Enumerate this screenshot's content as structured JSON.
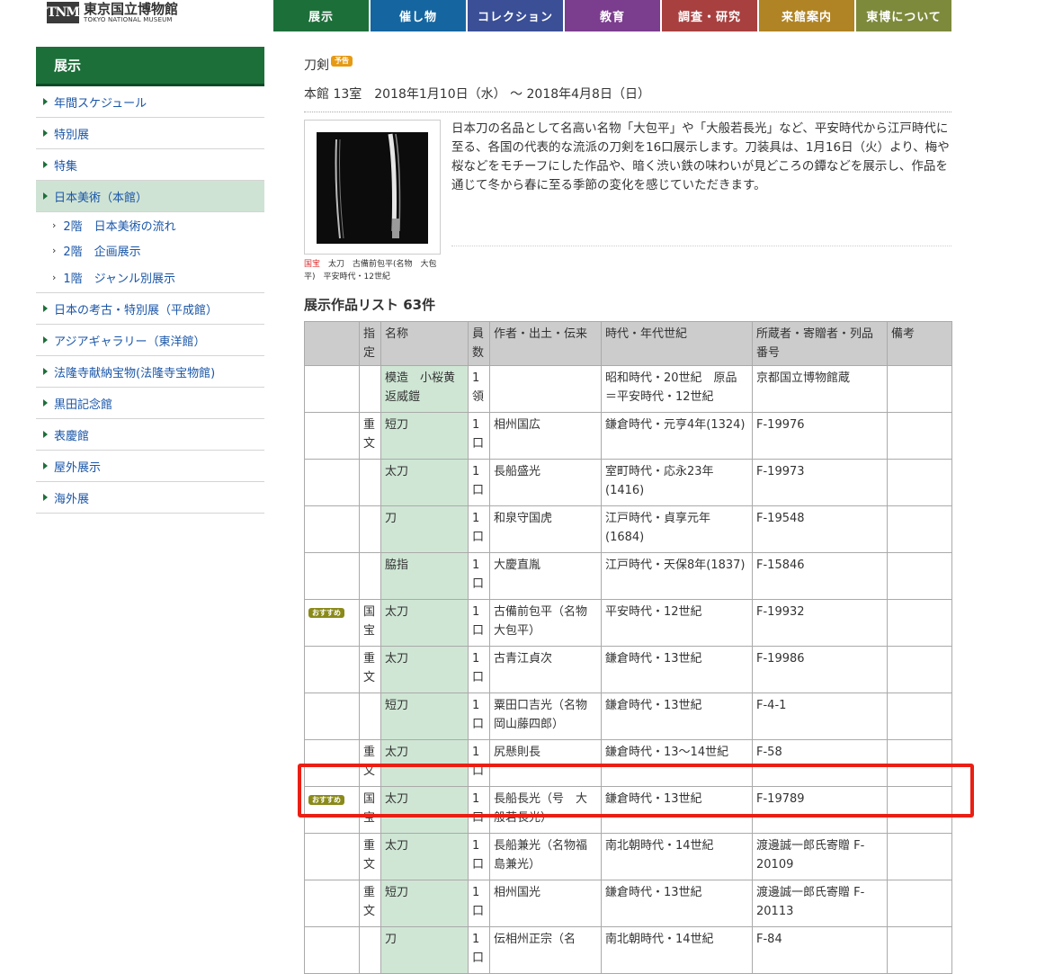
{
  "logo": {
    "mark": "TNM",
    "jp": "東京国立博物館",
    "en": "TOKYO NATIONAL MUSEUM"
  },
  "nav": [
    {
      "label": "展示",
      "color": "#1d6f3a"
    },
    {
      "label": "催し物",
      "color": "#1566a0"
    },
    {
      "label": "コレクション",
      "color": "#3a4f96"
    },
    {
      "label": "教育",
      "color": "#7b3d8e"
    },
    {
      "label": "調査・研究",
      "color": "#a84040"
    },
    {
      "label": "来館案内",
      "color": "#b08424"
    },
    {
      "label": "東博について",
      "color": "#7d8a3c"
    }
  ],
  "sidebar": {
    "heading": "展示",
    "items": [
      {
        "label": "年間スケジュール"
      },
      {
        "label": "特別展"
      },
      {
        "label": "特集"
      },
      {
        "label": "日本美術（本館）"
      },
      {
        "label": "2階　日本美術の流れ"
      },
      {
        "label": "2階　企画展示"
      },
      {
        "label": "1階　ジャンル別展示"
      },
      {
        "label": "日本の考古・特別展（平成館）"
      },
      {
        "label": "アジアギャラリー（東洋館）"
      },
      {
        "label": "法隆寺献納宝物(法隆寺宝物館)"
      },
      {
        "label": "黒田記念館"
      },
      {
        "label": "表慶館"
      },
      {
        "label": "屋外展示"
      },
      {
        "label": "海外展"
      }
    ]
  },
  "exhibit": {
    "title": "刀剣",
    "badge": "予告",
    "meta": "本館 13室　2018年1月10日（水） 〜 2018年4月8日（日）",
    "description": "日本刀の名品として名高い名物「大包平」や「大般若長光」など、平安時代から江戸時代に至る、各国の代表的な流派の刀剣を16口展示します。刀装具は、1月16日（火）より、梅や桜などをモチーフにした作品や、暗く渋い鉄の味わいが見どころの鐔などを展示し、作品を通じて冬から春に至る季節の変化を感じていただきます。",
    "caption_red": "国宝",
    "caption": "　太刀　古備前包平(名物　大包平)　平安時代・12世紀"
  },
  "list": {
    "title": "展示作品リスト 63件",
    "headers": [
      "",
      "指定",
      "名称",
      "員数",
      "作者・出土・伝来",
      "時代・年代世紀",
      "所蔵者・寄贈者・列品番号",
      "備考"
    ],
    "rows": [
      {
        "badge": "",
        "designation": "",
        "name": "模造　小桜黄返威鎧",
        "count": "1領",
        "author": "",
        "period": "昭和時代・20世紀　原品＝平安時代・12世紀",
        "owner": "京都国立博物館蔵",
        "note": ""
      },
      {
        "badge": "",
        "designation": "重文",
        "name": "短刀",
        "count": "1口",
        "author": "相州国広",
        "period": "鎌倉時代・元亨4年(1324)",
        "owner": "F-19976",
        "note": ""
      },
      {
        "badge": "",
        "designation": "",
        "name": "太刀",
        "count": "1口",
        "author": "長船盛光",
        "period": "室町時代・応永23年(1416)",
        "owner": "F-19973",
        "note": ""
      },
      {
        "badge": "",
        "designation": "",
        "name": "刀",
        "count": "1口",
        "author": "和泉守国虎",
        "period": "江戸時代・貞享元年(1684)",
        "owner": "F-19548",
        "note": ""
      },
      {
        "badge": "",
        "designation": "",
        "name": "脇指",
        "count": "1口",
        "author": "大慶直胤",
        "period": "江戸時代・天保8年(1837)",
        "owner": "F-15846",
        "note": ""
      },
      {
        "badge": "おすすめ",
        "designation": "国宝",
        "name": "太刀",
        "count": "1口",
        "author": "古備前包平（名物　大包平）",
        "period": "平安時代・12世紀",
        "owner": "F-19932",
        "note": ""
      },
      {
        "badge": "",
        "designation": "重文",
        "name": "太刀",
        "count": "1口",
        "author": "古青江貞次",
        "period": "鎌倉時代・13世紀",
        "owner": "F-19986",
        "note": ""
      },
      {
        "badge": "",
        "designation": "",
        "name": "短刀",
        "count": "1口",
        "author": "粟田口吉光（名物　岡山藤四郎）",
        "period": "鎌倉時代・13世紀",
        "owner": "F-4-1",
        "note": ""
      },
      {
        "badge": "",
        "designation": "重文",
        "name": "太刀",
        "count": "1口",
        "author": "尻懸則長",
        "period": "鎌倉時代・13〜14世紀",
        "owner": "F-58",
        "note": ""
      },
      {
        "badge": "おすすめ",
        "designation": "国宝",
        "name": "太刀",
        "count": "1口",
        "author": "長船長光（号　大般若長光）",
        "period": "鎌倉時代・13世紀",
        "owner": "F-19789",
        "note": ""
      },
      {
        "badge": "",
        "designation": "重文",
        "name": "太刀",
        "count": "1口",
        "author": "長船兼光（名物福島兼光）",
        "period": "南北朝時代・14世紀",
        "owner": "渡邊誠一郎氏寄贈 F-20109",
        "note": ""
      },
      {
        "badge": "",
        "designation": "重文",
        "name": "短刀",
        "count": "1口",
        "author": "相州国光",
        "period": "鎌倉時代・13世紀",
        "owner": "渡邊誠一郎氏寄贈 F-20113",
        "note": ""
      },
      {
        "badge": "",
        "designation": "",
        "name": "刀",
        "count": "1口",
        "author": "伝相州正宗（名",
        "period": "南北朝時代・14世紀",
        "owner": "F-84",
        "note": ""
      }
    ]
  }
}
